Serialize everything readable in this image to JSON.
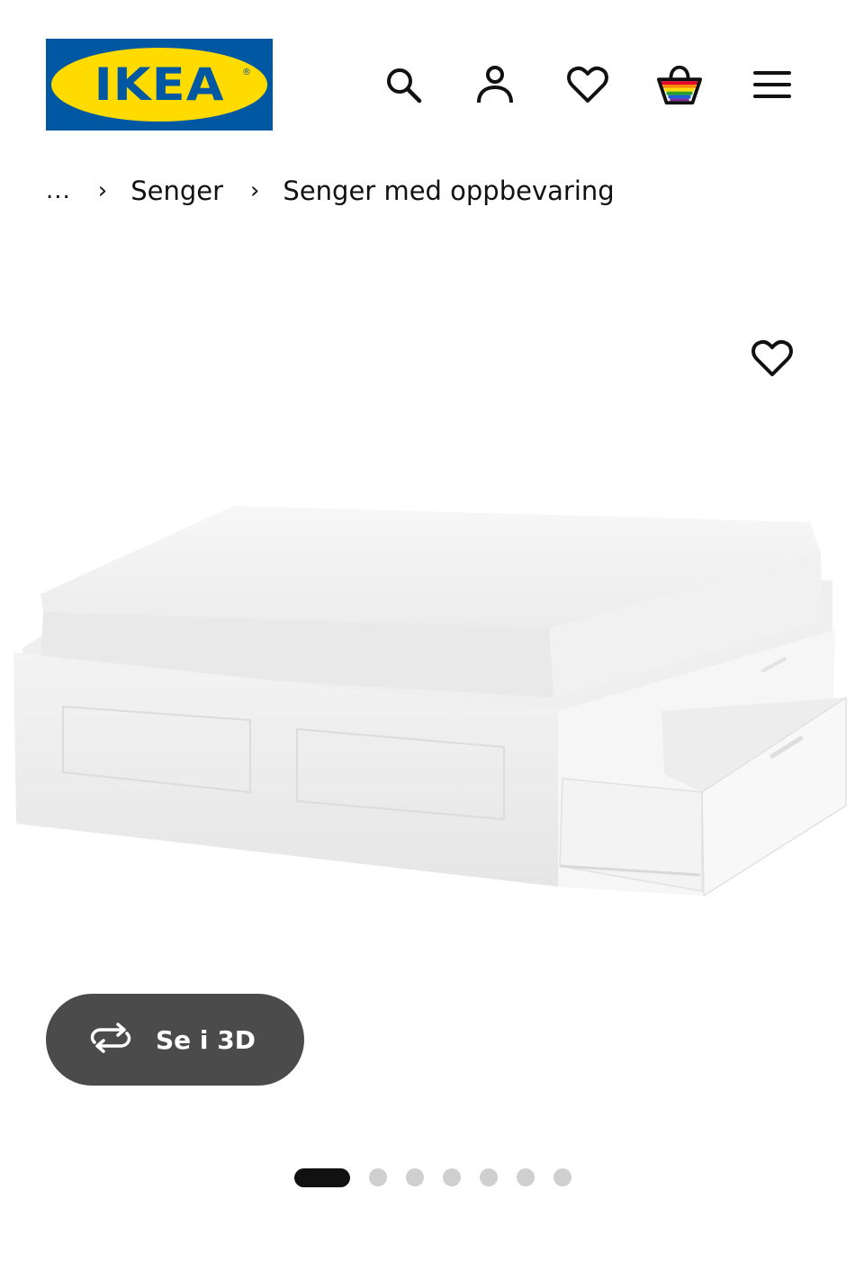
{
  "header": {
    "logo_text": "IKEA",
    "logo_registered": "®",
    "icons": [
      "search-icon",
      "account-icon",
      "favourites-icon",
      "basket-icon",
      "menu-icon"
    ]
  },
  "breadcrumb": {
    "ellipsis": "...",
    "separator": "›",
    "items": [
      "Senger",
      "Senger med oppbevaring"
    ]
  },
  "product_image": {
    "favourite_icon": "heart-icon",
    "view_3d_label": "Se i 3D",
    "view_3d_icon": "rotate-3d-icon"
  },
  "carousel": {
    "total": 7,
    "active_index": 0
  },
  "colors": {
    "ikea_blue": "#0058a3",
    "ikea_yellow": "#ffdb00",
    "button_dark": "#4b4b4b",
    "dot_inactive": "#cfcfcf",
    "dot_active": "#111111"
  }
}
